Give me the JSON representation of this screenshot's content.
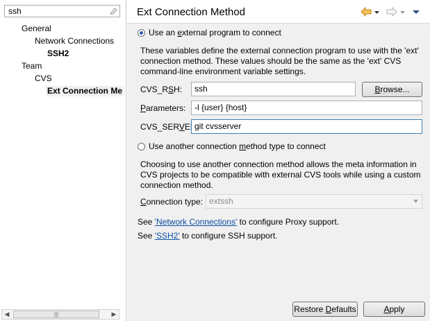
{
  "filter": {
    "value": "ssh"
  },
  "tree": {
    "general": "General",
    "network_connections": "Network Connections",
    "ssh2": "SSH2",
    "team": "Team",
    "cvs": "CVS",
    "ext_connection": "Ext Connection Me"
  },
  "page": {
    "title": "Ext Connection Method",
    "external_radio": {
      "pre": "Use an ",
      "mnemonic": "e",
      "post": "xternal program to connect",
      "selected": true
    },
    "external_description": [
      "These variables define the external connection program to use with the 'ext'",
      "connection method. These values should be the same as the 'ext' CVS",
      "command-line environment variable settings."
    ],
    "cvs_rsh": {
      "label_pre": "CVS_R",
      "label_mn": "S",
      "label_post": "H:",
      "value": "ssh"
    },
    "browse_button": {
      "pre": "",
      "mnemonic": "B",
      "post": "rowse..."
    },
    "parameters": {
      "label_pre": "",
      "label_mn": "P",
      "label_post": "arameters:",
      "value": "-l {user} {host}"
    },
    "cvs_server": {
      "label_pre": "CVS_SER",
      "label_mn": "V",
      "label_post": "ER:",
      "value": "git cvsserver"
    },
    "other_radio": {
      "pre": "Use another connection ",
      "mnemonic": "m",
      "post": "ethod type to connect",
      "selected": false
    },
    "other_description": [
      "Choosing to use another connection method allows the meta information in",
      "CVS projects to be compatible with external CVS tools while using a custom",
      "connection method."
    ],
    "connection_type": {
      "label_pre": "",
      "label_mn": "C",
      "label_post": "onnection type:",
      "value": "extssh"
    },
    "proxy_line": {
      "pre": "See ",
      "link": "'Network Connections'",
      "post": " to configure Proxy support."
    },
    "ssh_line": {
      "pre": "See ",
      "link": "'SSH2'",
      "post": " to configure SSH support."
    },
    "restore_button": {
      "pre": "Restore ",
      "mnemonic": "D",
      "post": "efaults"
    },
    "apply_button": {
      "pre": "",
      "mnemonic": "A",
      "post": "pply"
    }
  },
  "colors": {
    "link": "#0b4ea2",
    "radio_dot": "#2d5ea8",
    "nav_arrow": "#e8a33c"
  },
  "icons": [
    "clear-filter-icon",
    "back-arrow-icon",
    "forward-arrow-icon",
    "view-menu-icon",
    "dropdown-chevron-icon"
  ]
}
